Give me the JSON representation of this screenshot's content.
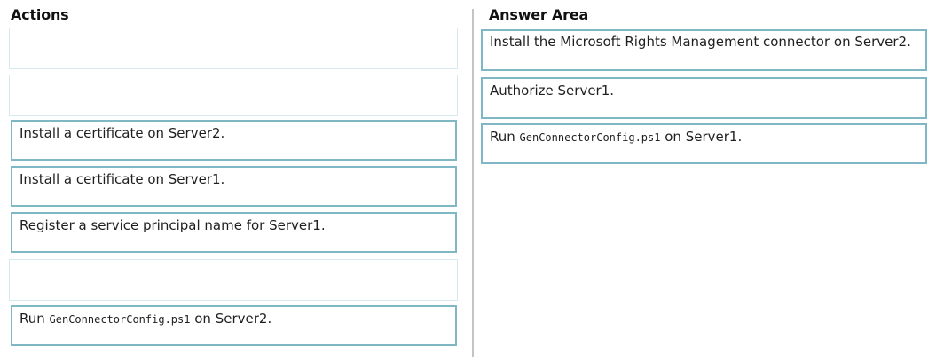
{
  "actions": {
    "heading": "Actions",
    "items": [
      {
        "text": ""
      },
      {
        "text": ""
      },
      {
        "text": "Install a certificate on Server2."
      },
      {
        "text": "Install a certificate on Server1."
      },
      {
        "text": "Register a service principal name for Server1."
      },
      {
        "text": ""
      },
      {
        "prefix": "Run ",
        "code": "GenConnectorConfig.ps1",
        "suffix": " on Server2."
      }
    ]
  },
  "answer_area": {
    "heading": "Answer Area",
    "items": [
      {
        "text": "Install the Microsoft Rights Management connector on Server2."
      },
      {
        "text": "Authorize Server1."
      },
      {
        "prefix": "Run ",
        "code": "GenConnectorConfig.ps1",
        "suffix": " on Server1."
      }
    ]
  },
  "colors": {
    "box_border": "#7fb7c5",
    "empty_slot_border": "#d5e9ee",
    "divider": "#c4c4c4"
  }
}
